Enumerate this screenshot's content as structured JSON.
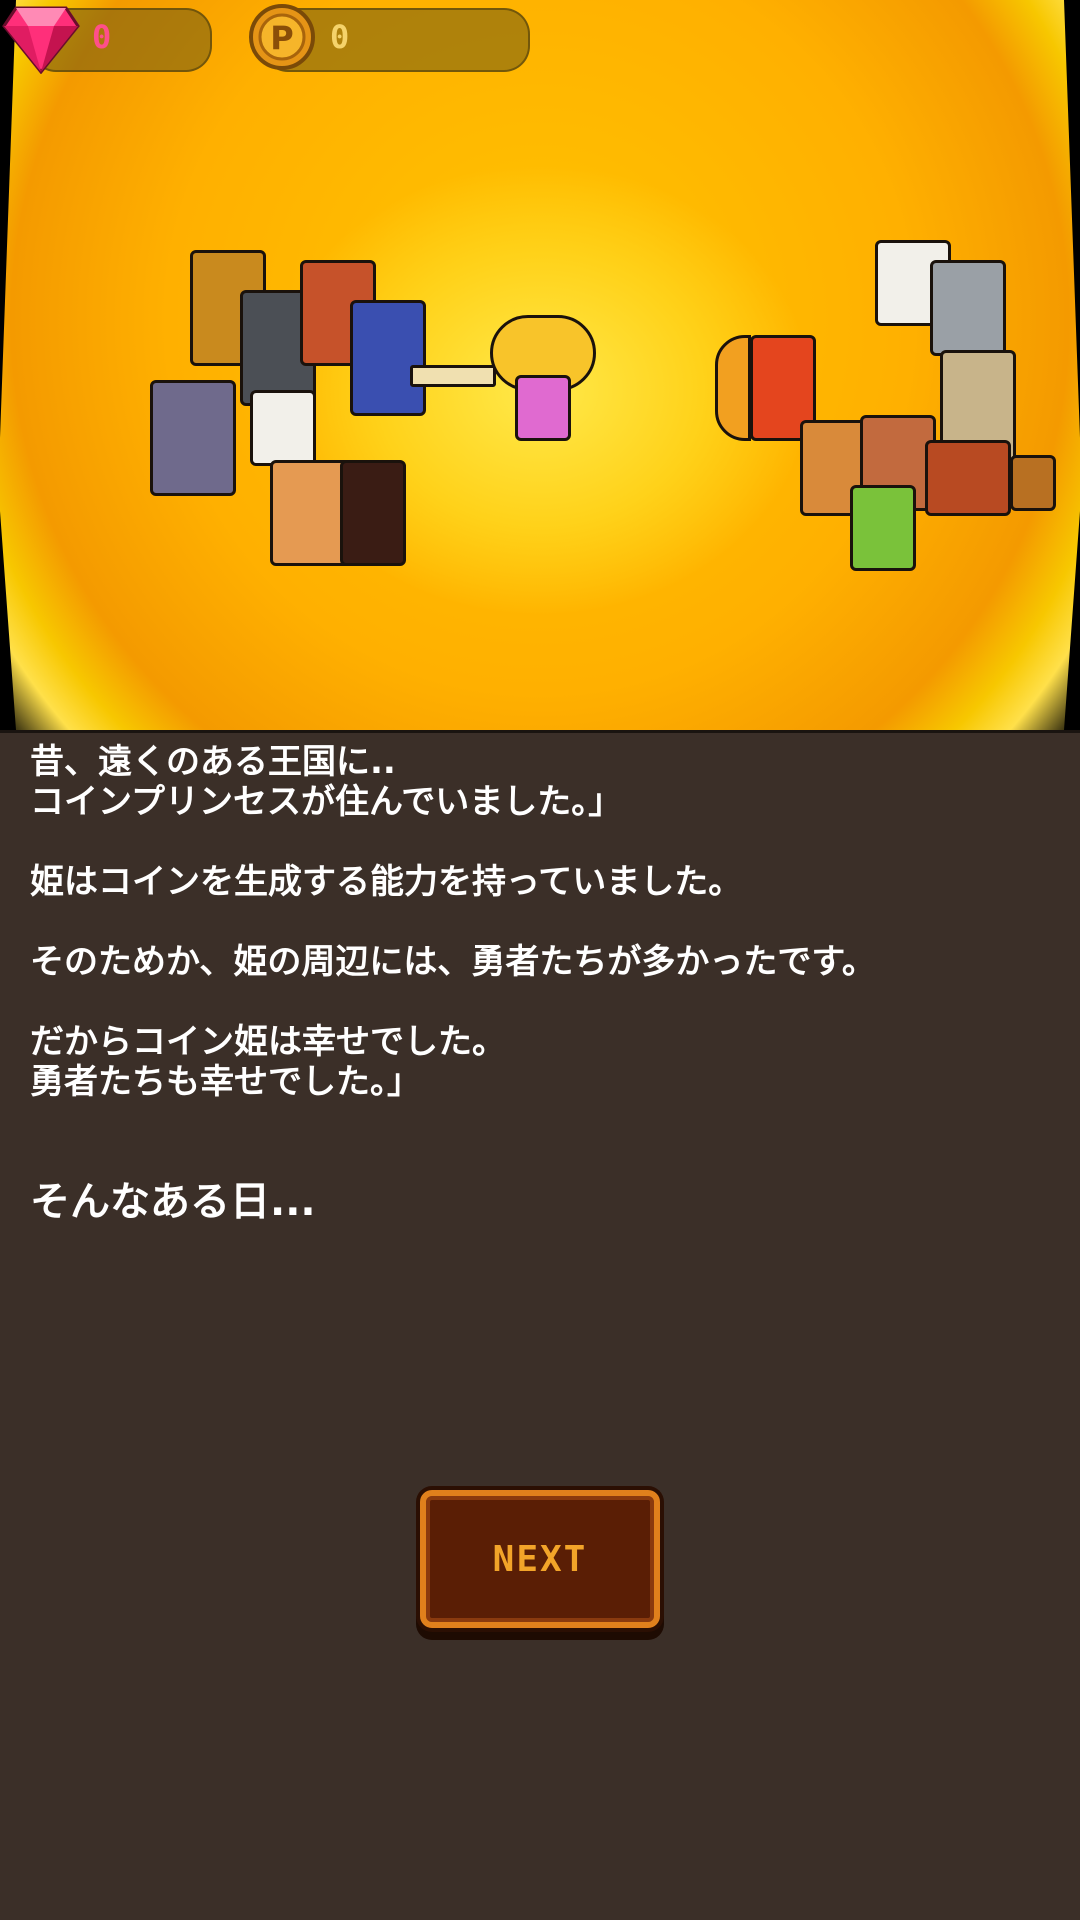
{
  "hud": {
    "gems": {
      "icon": "gem-icon",
      "value": "0"
    },
    "coins": {
      "icon": "coin-p-icon",
      "value": "0"
    }
  },
  "scene": {
    "description_icons": [
      "hero-party-left",
      "princess",
      "hero-party-right"
    ]
  },
  "story": {
    "lines": [
      "昔、遠くのある王国に..\nコインプリンセスが住んでいました。」",
      "姫はコインを生成する能力を持っていました。",
      "そのためか、姫の周辺には、勇者たちが多かったです。",
      "だからコイン姫は幸せでした。\n勇者たちも幸せでした。」",
      "そんなある日..."
    ]
  },
  "buttons": {
    "next_label": "NEXT"
  },
  "colors": {
    "panel_bg": "#3b2f28",
    "button_border": "#e0801c",
    "button_fill": "#5a1e05",
    "button_text": "#f2a429",
    "gem_text": "#ff4f8a",
    "coin_text": "#f5d36a"
  }
}
